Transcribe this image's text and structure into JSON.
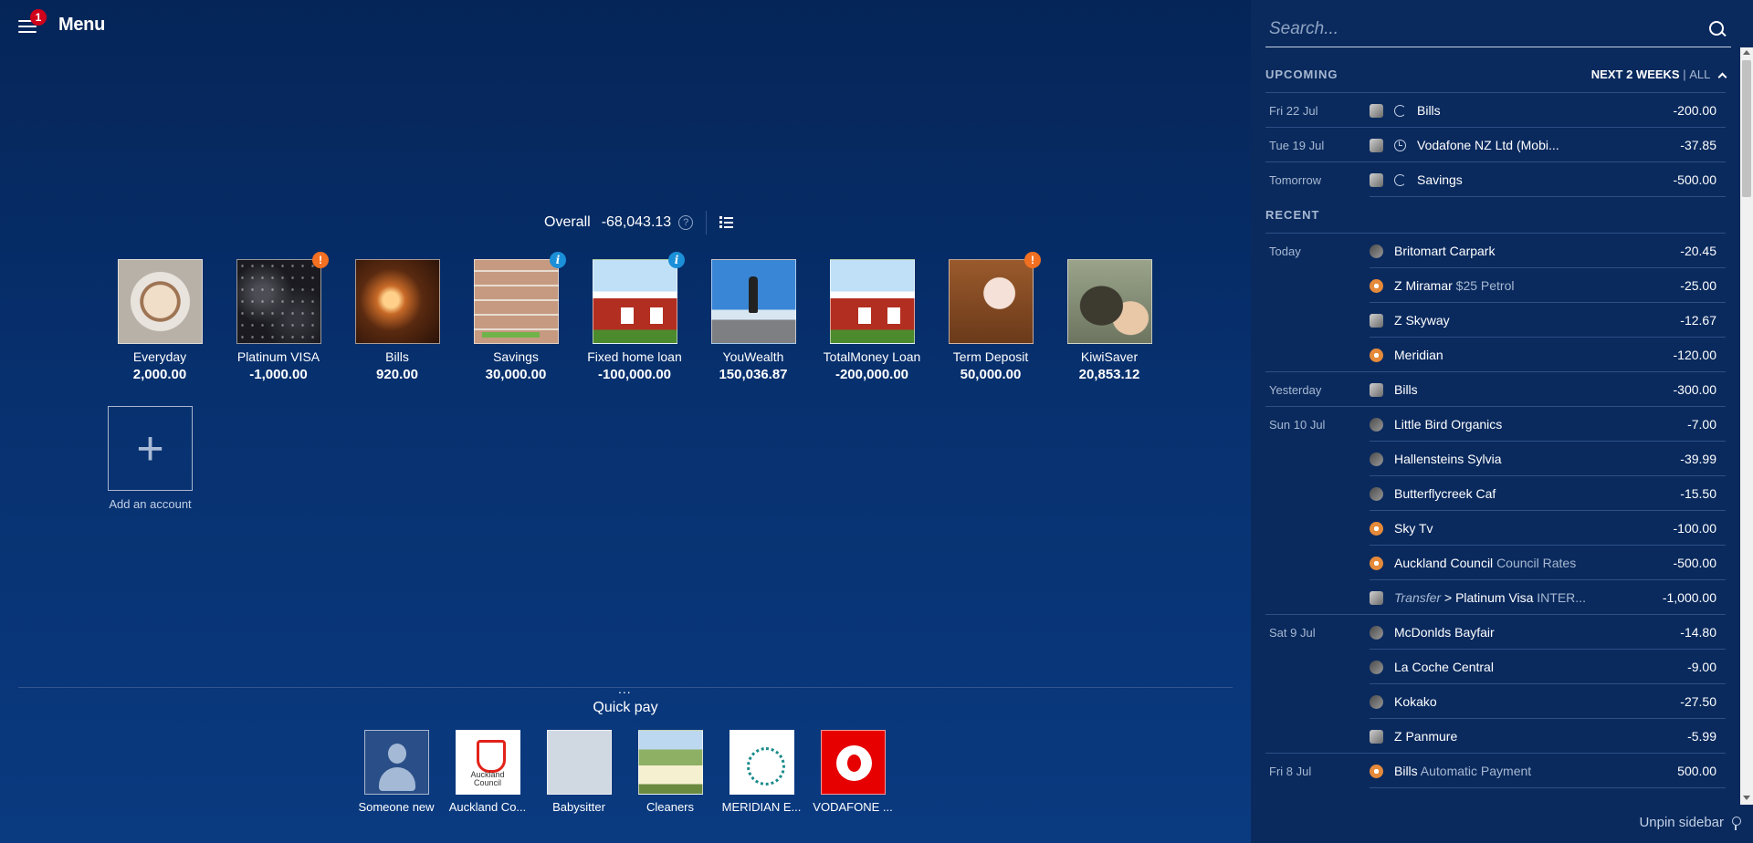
{
  "header": {
    "menu_label": "Menu",
    "menu_badge": "1"
  },
  "overall": {
    "label": "Overall",
    "value": "-68,043.13",
    "help_glyph": "?"
  },
  "accounts": [
    {
      "name": "Everyday",
      "balance": "2,000.00",
      "image": "img-coffee",
      "badge": ""
    },
    {
      "name": "Platinum VISA",
      "balance": "-1,000.00",
      "image": "img-space",
      "badge": "!"
    },
    {
      "name": "Bills",
      "balance": "920.00",
      "image": "img-bills",
      "badge": ""
    },
    {
      "name": "Savings",
      "balance": "30,000.00",
      "image": "img-brick",
      "badge": "i"
    },
    {
      "name": "Fixed home loan",
      "balance": "-100,000.00",
      "image": "img-house",
      "badge": "i"
    },
    {
      "name": "YouWealth",
      "balance": "150,036.87",
      "image": "img-mountain",
      "badge": ""
    },
    {
      "name": "TotalMoney Loan",
      "balance": "-200,000.00",
      "image": "img-house",
      "badge": ""
    },
    {
      "name": "Term Deposit",
      "balance": "50,000.00",
      "image": "img-piggy",
      "badge": "!"
    },
    {
      "name": "KiwiSaver",
      "balance": "20,853.12",
      "image": "img-kiwi",
      "badge": ""
    }
  ],
  "add_account": {
    "plus": "+",
    "label": "Add an account"
  },
  "quick_pay": {
    "dots": "...",
    "title": "Quick pay",
    "payees": [
      {
        "name": "Someone new",
        "pic": "pic-person"
      },
      {
        "name": "Auckland Co...",
        "pic": "pic-council",
        "logo_text": "Auckland Council"
      },
      {
        "name": "Babysitter",
        "pic": "pic-blank"
      },
      {
        "name": "Cleaners",
        "pic": "pic-cleaners"
      },
      {
        "name": "MERIDIAN E...",
        "pic": "pic-meridian"
      },
      {
        "name": "VODAFONE ...",
        "pic": "pic-vodafone"
      }
    ]
  },
  "sidebar": {
    "search_placeholder": "Search...",
    "upcoming": {
      "heading": "UPCOMING",
      "range_active": "NEXT 2 WEEKS",
      "range_sep": "|",
      "range_all": "ALL",
      "items": [
        {
          "date": "Fri 22 Jul",
          "thumb": "t-grey",
          "icon": "recur",
          "name": "Bills",
          "sub": "",
          "amount": "-200.00",
          "group_end": true
        },
        {
          "date": "Tue 19 Jul",
          "thumb": "t-grey",
          "icon": "clock",
          "name": "Vodafone NZ Ltd (Mobi...",
          "sub": "",
          "amount": "-37.85",
          "group_end": true
        },
        {
          "date": "Tomorrow",
          "thumb": "t-grey",
          "icon": "recur",
          "name": "Savings",
          "sub": "",
          "amount": "-500.00",
          "group_end": false
        }
      ]
    },
    "recent": {
      "heading": "RECENT",
      "items": [
        {
          "date": "Today",
          "thumb": "t-dark",
          "name": "Britomart Carpark",
          "sub": "",
          "amount": "-20.45",
          "group_end": false
        },
        {
          "date": "",
          "thumb": "t-orange",
          "name": "Z Miramar",
          "sub": "$25 Petrol",
          "amount": "-25.00",
          "group_end": false
        },
        {
          "date": "",
          "thumb": "t-grey",
          "name": "Z Skyway",
          "sub": "",
          "amount": "-12.67",
          "group_end": false
        },
        {
          "date": "",
          "thumb": "t-orange",
          "name": "Meridian",
          "sub": "",
          "amount": "-120.00",
          "group_end": true
        },
        {
          "date": "Yesterday",
          "thumb": "t-grey",
          "name": "Bills",
          "sub": "",
          "amount": "-300.00",
          "group_end": true
        },
        {
          "date": "Sun 10 Jul",
          "thumb": "t-dark",
          "name": "Little Bird Organics",
          "sub": "",
          "amount": "-7.00",
          "group_end": false
        },
        {
          "date": "",
          "thumb": "t-dark",
          "name": "Hallensteins Sylvia",
          "sub": "",
          "amount": "-39.99",
          "group_end": false
        },
        {
          "date": "",
          "thumb": "t-dark",
          "name": "Butterflycreek Caf",
          "sub": "",
          "amount": "-15.50",
          "group_end": false
        },
        {
          "date": "",
          "thumb": "t-orange",
          "name": "Sky Tv",
          "sub": "",
          "amount": "-100.00",
          "group_end": false
        },
        {
          "date": "",
          "thumb": "t-orange",
          "name": "Auckland Council",
          "sub": "Council Rates",
          "amount": "-500.00",
          "group_end": false
        },
        {
          "date": "",
          "thumb": "t-grey",
          "prefix": "Transfer",
          "arrow": ">",
          "name": "Platinum Visa",
          "sub": "INTER...",
          "amount": "-1,000.00",
          "group_end": true
        },
        {
          "date": "Sat 9 Jul",
          "thumb": "t-dark",
          "name": "McDonlds Bayfair",
          "sub": "",
          "amount": "-14.80",
          "group_end": false
        },
        {
          "date": "",
          "thumb": "t-dark",
          "name": "La Coche Central",
          "sub": "",
          "amount": "-9.00",
          "group_end": false
        },
        {
          "date": "",
          "thumb": "t-dark",
          "name": "Kokako",
          "sub": "",
          "amount": "-27.50",
          "group_end": false
        },
        {
          "date": "",
          "thumb": "t-grey",
          "name": "Z Panmure",
          "sub": "",
          "amount": "-5.99",
          "group_end": true
        },
        {
          "date": "Fri 8 Jul",
          "thumb": "t-orange",
          "name": "Bills",
          "sub": "Automatic Payment",
          "amount": "500.00",
          "group_end": false
        }
      ]
    },
    "unpin_label": "Unpin sidebar"
  }
}
